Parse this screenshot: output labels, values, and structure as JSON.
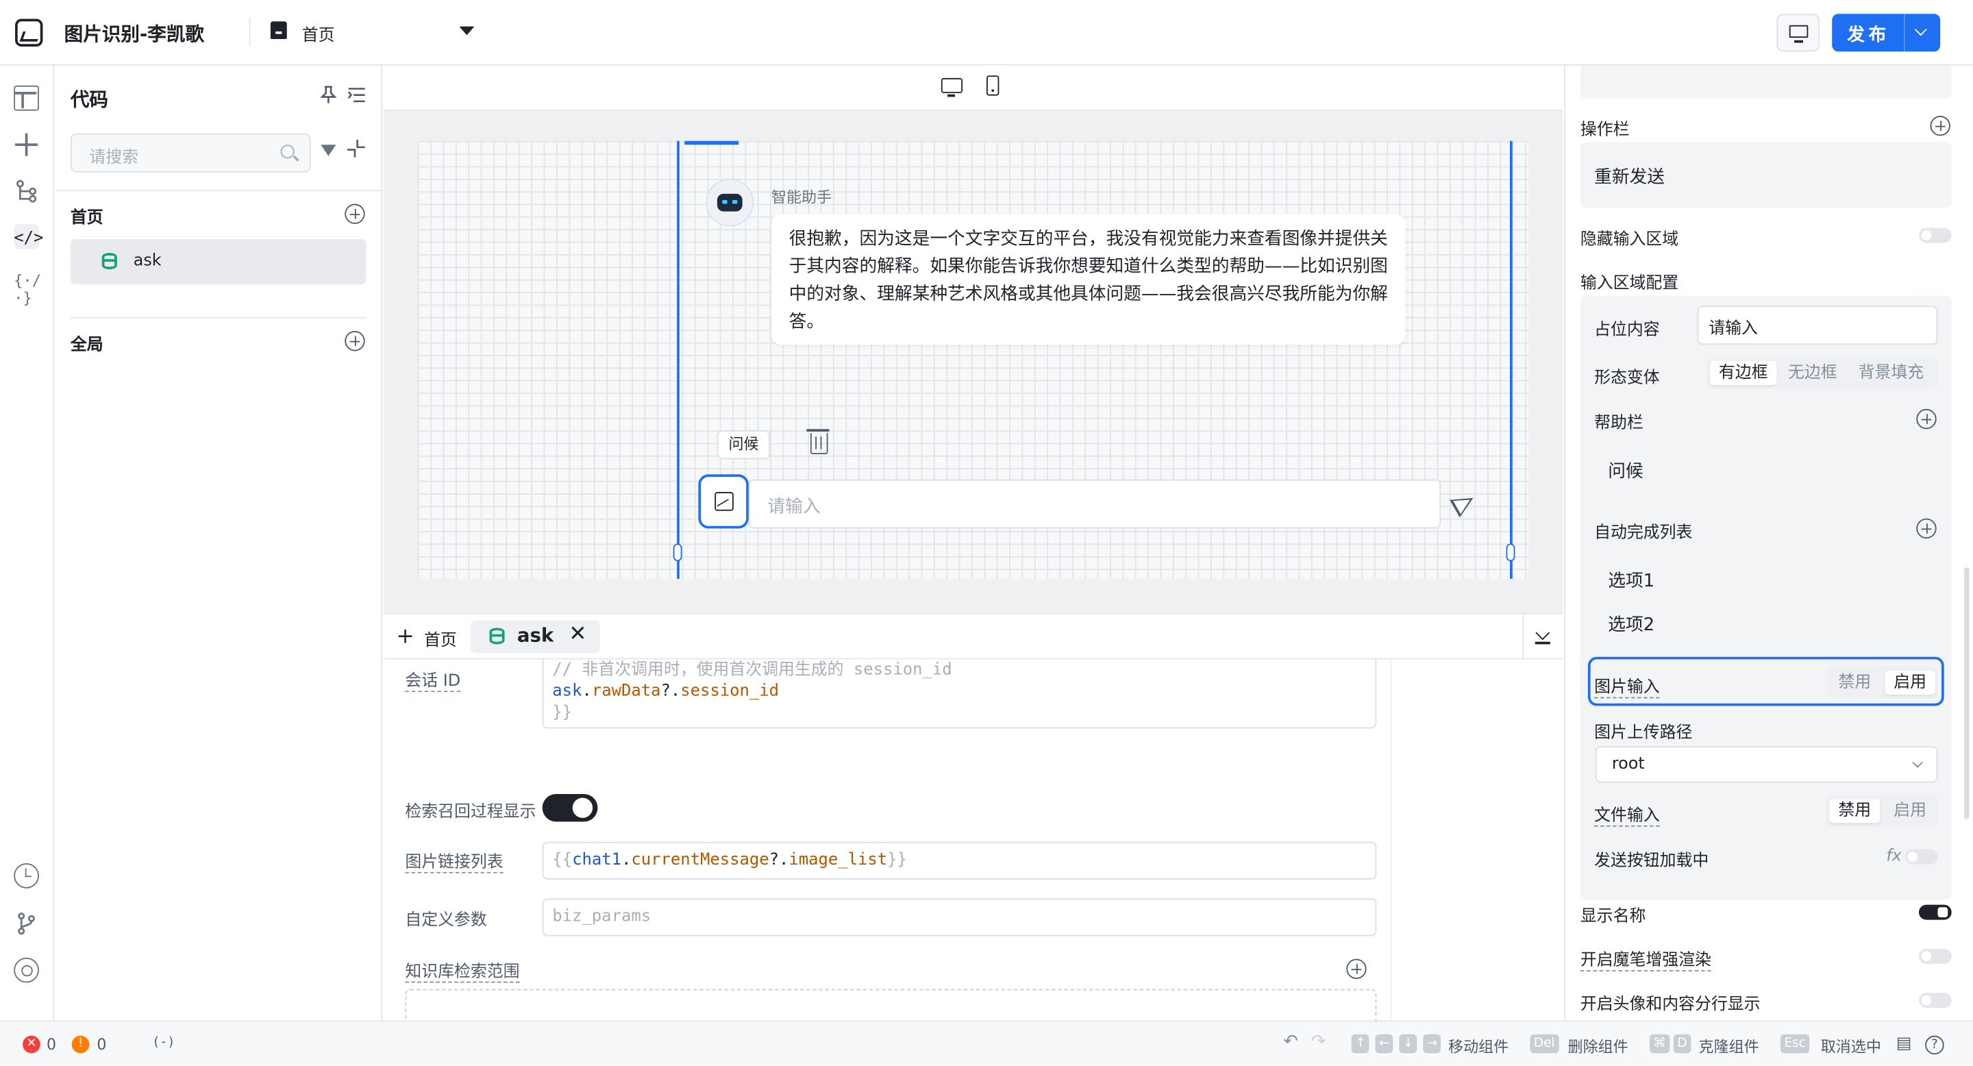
{
  "app": {
    "title": "图片识别-李凯歌",
    "current_page": "首页",
    "publish_label": "发布"
  },
  "code_panel": {
    "title": "代码",
    "search_placeholder": "请搜索",
    "sections": [
      {
        "label": "首页",
        "items": [
          {
            "label": "ask"
          }
        ]
      },
      {
        "label": "全局",
        "items": []
      }
    ]
  },
  "canvas": {
    "bot_name": "智能助手",
    "bot_message": "很抱歉，因为这是一个文字交互的平台，我没有视觉能力来查看图像并提供关于其内容的解释。如果你能告诉我你想要知道什么类型的帮助——比如识别图中的对象、理解某种艺术风格或其他具体问题——我会很高兴尽我所能为你解答。",
    "quick_chip": "问候",
    "input_placeholder": "请输入"
  },
  "editor": {
    "tabs": {
      "home": "首页",
      "active": "ask"
    },
    "session_label": "会话 ID",
    "session_code": {
      "comment": "// 非首次调用时，使用首次调用生成的 session_id",
      "obj": "ask",
      "dot1": ".",
      "prop1": "rawData",
      "dot2": "?.",
      "prop2": "session_id",
      "close": "}}"
    },
    "retrieval_label": "检索召回过程显示",
    "image_list_label": "图片链接列表",
    "image_list_code": {
      "open": "{{",
      "obj": "chat1",
      "dot1": ".",
      "prop1": "currentMessage",
      "dot2": "?.",
      "prop2": "image_list",
      "close": "}}"
    },
    "custom_params_label": "自定义参数",
    "custom_params_placeholder": "biz_params",
    "kb_scope_label": "知识库检索范围"
  },
  "right_panel": {
    "actionbar_label": "操作栏",
    "actionbar_item": "重新发送",
    "hide_input_label": "隐藏输入区域",
    "input_config_label": "输入区域配置",
    "placeholder_label": "占位内容",
    "placeholder_value": "请输入",
    "variant_label": "形态变体",
    "variant_options": [
      "有边框",
      "无边框",
      "背景填充"
    ],
    "helpbar_label": "帮助栏",
    "helpbar_item": "问候",
    "autocomplete_label": "自动完成列表",
    "autocomplete_items": [
      "选项1",
      "选项2"
    ],
    "image_input_label": "图片输入",
    "image_input_options": [
      "禁用",
      "启用"
    ],
    "upload_path_label": "图片上传路径",
    "upload_path_value": "root",
    "file_input_label": "文件输入",
    "file_input_options": [
      "禁用",
      "启用"
    ],
    "send_loading_label": "发送按钮加载中",
    "fx_label": "fx",
    "show_name_label": "显示名称",
    "enhanced_render_label": "开启魔笔增强渲染",
    "avatar_split_label": "开启头像和内容分行显示"
  },
  "status_bar": {
    "errors": "0",
    "warnings": "0",
    "var_icon": "(-)",
    "move_label": "移动组件",
    "delete_key": "Del",
    "delete_label": "删除组件",
    "clone_key": "D",
    "clone_label": "克隆组件",
    "esc_key": "Esc",
    "deselect_label": "取消选中"
  }
}
